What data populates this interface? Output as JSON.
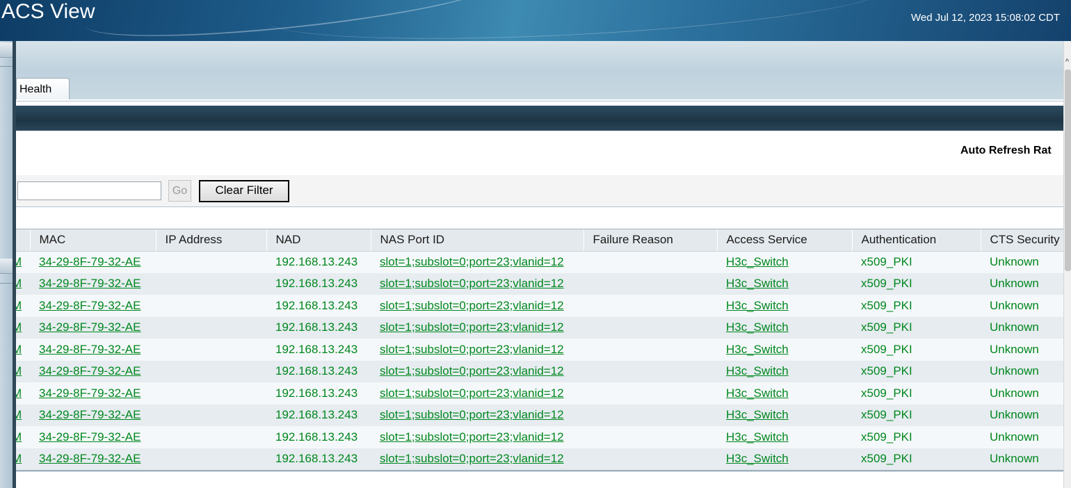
{
  "header": {
    "app_title": "ACS View",
    "datetime": "Wed Jul 12, 2023 15:08:02 CDT"
  },
  "tabs": [
    {
      "label": "Health"
    }
  ],
  "toolbar": {
    "auto_refresh_label": "Auto Refresh Rat",
    "filter_value": "",
    "go_label": "Go",
    "clear_filter_label": "Clear Filter"
  },
  "table": {
    "columns": [
      "",
      "MAC",
      "IP Address",
      "NAD",
      "NAS Port ID",
      "Failure Reason",
      "Access Service",
      "Authentication",
      "CTS Security"
    ],
    "rows": [
      [
        "M",
        "34-29-8F-79-32-AE",
        "",
        "192.168.13.243",
        "slot=1;subslot=0;port=23;vlanid=12",
        "",
        "H3c_Switch",
        "x509_PKI",
        "Unknown"
      ],
      [
        "M",
        "34-29-8F-79-32-AE",
        "",
        "192.168.13.243",
        "slot=1;subslot=0;port=23;vlanid=12",
        "",
        "H3c_Switch",
        "x509_PKI",
        "Unknown"
      ],
      [
        "M",
        "34-29-8F-79-32-AE",
        "",
        "192.168.13.243",
        "slot=1;subslot=0;port=23;vlanid=12",
        "",
        "H3c_Switch",
        "x509_PKI",
        "Unknown"
      ],
      [
        "M",
        "34-29-8F-79-32-AE",
        "",
        "192.168.13.243",
        "slot=1;subslot=0;port=23;vlanid=12",
        "",
        "H3c_Switch",
        "x509_PKI",
        "Unknown"
      ],
      [
        "M",
        "34-29-8F-79-32-AE",
        "",
        "192.168.13.243",
        "slot=1;subslot=0;port=23;vlanid=12",
        "",
        "H3c_Switch",
        "x509_PKI",
        "Unknown"
      ],
      [
        "M",
        "34-29-8F-79-32-AE",
        "",
        "192.168.13.243",
        "slot=1;subslot=0;port=23;vlanid=12",
        "",
        "H3c_Switch",
        "x509_PKI",
        "Unknown"
      ],
      [
        "M",
        "34-29-8F-79-32-AE",
        "",
        "192.168.13.243",
        "slot=1;subslot=0;port=23;vlanid=12",
        "",
        "H3c_Switch",
        "x509_PKI",
        "Unknown"
      ],
      [
        "M",
        "34-29-8F-79-32-AE",
        "",
        "192.168.13.243",
        "slot=1;subslot=0;port=23;vlanid=12",
        "",
        "H3c_Switch",
        "x509_PKI",
        "Unknown"
      ],
      [
        "M",
        "34-29-8F-79-32-AE",
        "",
        "192.168.13.243",
        "slot=1;subslot=0;port=23;vlanid=12",
        "",
        "H3c_Switch",
        "x509_PKI",
        "Unknown"
      ],
      [
        "M",
        "34-29-8F-79-32-AE",
        "",
        "192.168.13.243",
        "slot=1;subslot=0;port=23;vlanid=12",
        "",
        "H3c_Switch",
        "x509_PKI",
        "Unknown"
      ]
    ]
  },
  "colors": {
    "link_green": "#00871e",
    "banner_blue": "#1f5d8b"
  },
  "icons": {
    "scroll_up": "chevron-up-icon",
    "rail_grip": "grip-icon"
  }
}
